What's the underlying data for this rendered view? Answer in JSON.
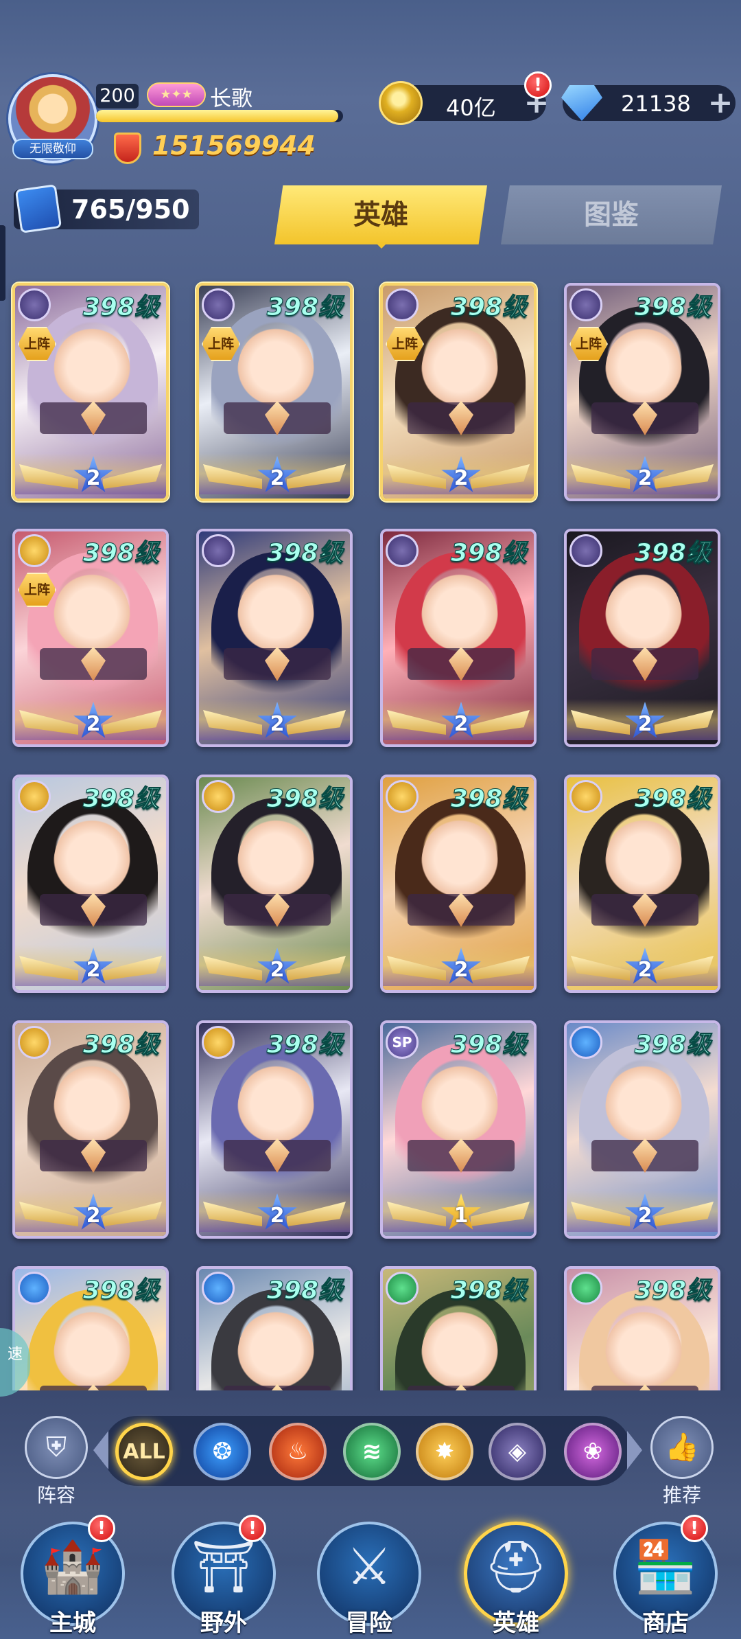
{
  "header": {
    "avatar_tag": "无限敬仰",
    "level": "200",
    "vip_badge": "",
    "player_name": "长歌",
    "exp_fraction": 0.98,
    "power": "151569944",
    "coins": "40亿",
    "gems": "21138",
    "plus": "+",
    "alert": "!"
  },
  "collection": {
    "count": "765/950"
  },
  "tabs": [
    {
      "label": "英雄",
      "active": true
    },
    {
      "label": "图鉴",
      "active": false
    }
  ],
  "heroes": [
    {
      "level": "398级",
      "faction": "void",
      "deployed": true,
      "deploy_label": "上阵",
      "stars": "2",
      "star_color": "blue",
      "frame": "gold",
      "palette": [
        "#f7f1f6",
        "#c6b5d8",
        "#8a6a9a"
      ]
    },
    {
      "level": "398级",
      "faction": "void",
      "deployed": true,
      "deploy_label": "上阵",
      "stars": "2",
      "star_color": "blue",
      "frame": "gold",
      "palette": [
        "#eaeef6",
        "#9aa3bf",
        "#3a3f55"
      ]
    },
    {
      "level": "398级",
      "faction": "void",
      "deployed": true,
      "deploy_label": "上阵",
      "stars": "2",
      "star_color": "blue",
      "frame": "gold",
      "palette": [
        "#f5e0c0",
        "#3c2a22",
        "#c89a6a"
      ]
    },
    {
      "level": "398级",
      "faction": "void",
      "deployed": true,
      "deploy_label": "上阵",
      "stars": "2",
      "star_color": "blue",
      "frame": "purple",
      "palette": [
        "#f3d9c8",
        "#222028",
        "#6f5c7a"
      ]
    },
    {
      "level": "398级",
      "faction": "light",
      "deployed": true,
      "deploy_label": "上阵",
      "stars": "2",
      "star_color": "blue",
      "frame": "purple",
      "palette": [
        "#fbd4d8",
        "#f4a4b6",
        "#c65a6e"
      ]
    },
    {
      "level": "398级",
      "faction": "void",
      "deployed": false,
      "deploy_label": "",
      "stars": "2",
      "star_color": "blue",
      "frame": "purple",
      "palette": [
        "#e0c0a0",
        "#1a1f4a",
        "#2f3b7a"
      ]
    },
    {
      "level": "398级",
      "faction": "void",
      "deployed": false,
      "deploy_label": "",
      "stars": "2",
      "star_color": "blue",
      "frame": "purple",
      "palette": [
        "#ffb0b8",
        "#d23a4a",
        "#7e2a3e"
      ]
    },
    {
      "level": "398级",
      "faction": "void",
      "deployed": false,
      "deploy_label": "",
      "stars": "2",
      "star_color": "blue",
      "frame": "purple",
      "palette": [
        "#3a3040",
        "#8a1e2a",
        "#1a1820"
      ]
    },
    {
      "level": "398级",
      "faction": "light",
      "deployed": false,
      "deploy_label": "",
      "stars": "2",
      "star_color": "blue",
      "frame": "purple",
      "palette": [
        "#f2dccc",
        "#1e1a1a",
        "#b8c8e0"
      ]
    },
    {
      "level": "398级",
      "faction": "light",
      "deployed": false,
      "deploy_label": "",
      "stars": "2",
      "star_color": "blue",
      "frame": "purple",
      "palette": [
        "#f0dcd0",
        "#24202a",
        "#6a8a50"
      ]
    },
    {
      "level": "398级",
      "faction": "light",
      "deployed": false,
      "deploy_label": "",
      "stars": "2",
      "star_color": "blue",
      "frame": "purple",
      "palette": [
        "#f4d2b0",
        "#4a2a1a",
        "#e0a040"
      ]
    },
    {
      "level": "398级",
      "faction": "light",
      "deployed": false,
      "deploy_label": "",
      "stars": "2",
      "star_color": "blue",
      "frame": "purple",
      "palette": [
        "#f2dcc0",
        "#2a2420",
        "#e8c040"
      ]
    },
    {
      "level": "398级",
      "faction": "light",
      "deployed": false,
      "deploy_label": "",
      "stars": "2",
      "star_color": "blue",
      "frame": "purple",
      "palette": [
        "#eed8c8",
        "#5a4a48",
        "#c8a890"
      ]
    },
    {
      "level": "398级",
      "faction": "light",
      "deployed": false,
      "deploy_label": "",
      "stars": "2",
      "star_color": "blue",
      "frame": "purple",
      "palette": [
        "#e8e8f4",
        "#6a6ab0",
        "#32305a"
      ]
    },
    {
      "level": "398级",
      "faction": "sp",
      "faction_label": "SP",
      "deployed": false,
      "deploy_label": "",
      "stars": "1",
      "star_color": "gold",
      "frame": "purple",
      "palette": [
        "#ffd8d8",
        "#f0a0b8",
        "#4a6a9a"
      ]
    },
    {
      "level": "398级",
      "faction": "water",
      "deployed": false,
      "deploy_label": "",
      "stars": "2",
      "star_color": "blue",
      "frame": "purple",
      "palette": [
        "#f4dcd0",
        "#c0c0d8",
        "#6a8ac8"
      ]
    },
    {
      "level": "398级",
      "faction": "water",
      "deployed": false,
      "deploy_label": "",
      "stars": "",
      "star_color": "blue",
      "frame": "purple",
      "palette": [
        "#ffe0b8",
        "#f0c040",
        "#9ab8e8"
      ]
    },
    {
      "level": "398级",
      "faction": "water",
      "deployed": false,
      "deploy_label": "",
      "stars": "",
      "star_color": "blue",
      "frame": "purple",
      "palette": [
        "#e8e8e8",
        "#3a3a40",
        "#6a88b0"
      ]
    },
    {
      "level": "398级",
      "faction": "wind",
      "deployed": false,
      "deploy_label": "",
      "stars": "",
      "star_color": "blue",
      "frame": "purple",
      "palette": [
        "#6a8a5a",
        "#2a3a2a",
        "#c8b878"
      ]
    },
    {
      "level": "398级",
      "faction": "wind",
      "deployed": false,
      "deploy_label": "",
      "stars": "",
      "star_color": "blue",
      "frame": "purple",
      "palette": [
        "#fae4d8",
        "#f0c8a0",
        "#c890a8"
      ]
    }
  ],
  "filters": [
    {
      "label": "ALL",
      "kind": "all",
      "active": true
    },
    {
      "label": "",
      "kind": "water",
      "icon": "water-faction-icon"
    },
    {
      "label": "",
      "kind": "fire",
      "icon": "fire-faction-icon"
    },
    {
      "label": "",
      "kind": "wind",
      "icon": "wind-faction-icon"
    },
    {
      "label": "",
      "kind": "light",
      "icon": "light-faction-icon"
    },
    {
      "label": "",
      "kind": "void",
      "icon": "void-faction-icon"
    },
    {
      "label": "",
      "kind": "dark",
      "icon": "dark-faction-icon"
    }
  ],
  "side": {
    "lineup_label": "阵容",
    "recommend_label": "推荐"
  },
  "nav": [
    {
      "label": "主城",
      "icon": "castle-icon",
      "alert": true,
      "active": false
    },
    {
      "label": "野外",
      "icon": "portal-icon",
      "alert": true,
      "active": false
    },
    {
      "label": "冒险",
      "icon": "sword-icon",
      "alert": false,
      "active": false
    },
    {
      "label": "英雄",
      "icon": "helmet-icon",
      "alert": false,
      "active": true
    },
    {
      "label": "商店",
      "icon": "shop-icon",
      "alert": true,
      "active": false
    }
  ],
  "speed_label": "速"
}
